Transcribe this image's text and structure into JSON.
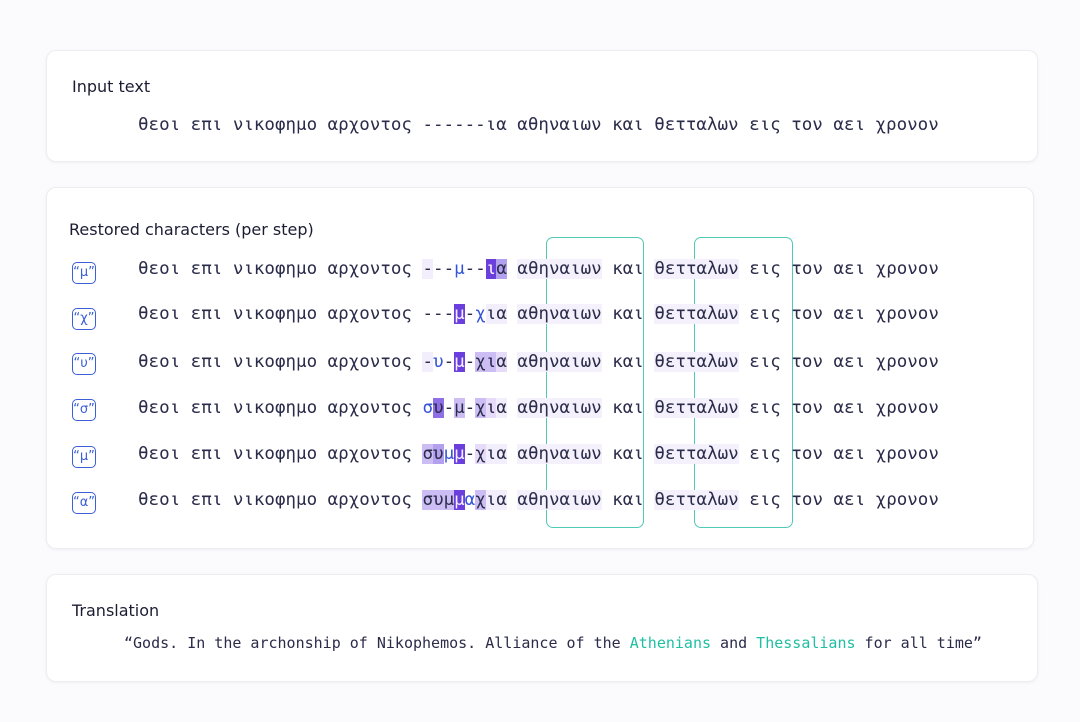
{
  "input": {
    "heading": "Input text",
    "text": "θεοι επι νικοφημο αρχοντος ------ια αθηναιων και θετταλων εις τον αει χρονον"
  },
  "restore": {
    "heading": "Restored characters (per step)",
    "prefix": "θεοι επι νικοφημο αρχοντος ",
    "word_athenians": "αθηναιων",
    "word_kai": " και ",
    "word_thessalians": "θετταλων",
    "suffix": " εις τον αει χρονον",
    "steps": [
      {
        "icon": "“μ”",
        "missing": "---μ--ια"
      },
      {
        "icon": "“χ”",
        "missing": "---μ-χια"
      },
      {
        "icon": "“υ”",
        "missing": "-υ-μ-χια"
      },
      {
        "icon": "“σ”",
        "missing": "συ-μ-χια"
      },
      {
        "icon": "“μ”",
        "missing": "συμμ-χια"
      },
      {
        "icon": "“α”",
        "missing": "συμμαχια"
      }
    ],
    "row_chars": [
      [
        "-",
        "-",
        "-",
        "μ",
        "-",
        "-",
        "ι",
        "α"
      ],
      [
        "-",
        "-",
        "-",
        "μ",
        "-",
        "χ",
        "ι",
        "α"
      ],
      [
        "-",
        "υ",
        "-",
        "μ",
        "-",
        "χ",
        "ι",
        "α"
      ],
      [
        "σ",
        "υ",
        "-",
        "μ",
        "-",
        "χ",
        "ι",
        "α"
      ],
      [
        "σ",
        "υ",
        "μ",
        "μ",
        "-",
        "χ",
        "ι",
        "α"
      ],
      [
        "σ",
        "υ",
        "μ",
        "μ",
        "α",
        "χ",
        "ι",
        "α"
      ]
    ]
  },
  "translation": {
    "heading": "Translation",
    "open_quote": "“",
    "part1": "Gods. In the archonship of Nikophemos. Alliance of the ",
    "athenians": "Athenians",
    "and": " and ",
    "thessalians": "Thessalians",
    "part2": " for all time",
    "close_quote": "”"
  },
  "colors": {
    "accent_teal": "#52c9b7",
    "accent_purple": "#6a3fdc",
    "icon_blue": "#3a5fd6"
  }
}
